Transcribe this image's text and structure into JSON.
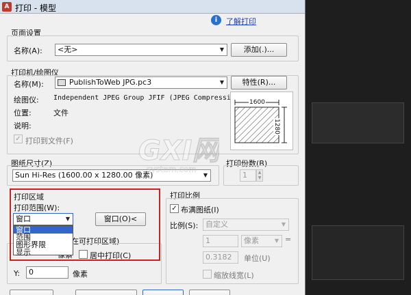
{
  "window": {
    "title": "打印 - 模型",
    "app_icon": "A"
  },
  "help": {
    "link": "了解打印"
  },
  "page_setup": {
    "group_label": "页面设置",
    "name_label": "名称(A):",
    "name_value": "<无>",
    "add_button": "添加(.)..."
  },
  "printer": {
    "group_label": "打印机/绘图仪",
    "name_label": "名称(M):",
    "name_value": "PublishToWeb JPG.pc3",
    "properties_button": "特性(R)...",
    "plotter_label": "绘图仪:",
    "plotter_value": "Independent JPEG Group JFIF (JPEG Compressi...",
    "location_label": "位置:",
    "location_value": "文件",
    "description_label": "说明:",
    "plot_to_file_label": "打印到文件(F)",
    "preview_width": "1600",
    "preview_height": "1280"
  },
  "paper_size": {
    "group_label": "图纸尺寸(Z)",
    "value": "Sun Hi-Res (1600.00 x 1280.00 像素)"
  },
  "copies": {
    "group_label": "打印份数(B)",
    "value": "1"
  },
  "plot_area": {
    "group_label": "打印区域",
    "range_label": "打印范围(W):",
    "range_value": "窗口",
    "window_button": "窗口(O)<",
    "options": [
      "窗口",
      "范围",
      "图形界限",
      "显示"
    ],
    "selected_index": 0
  },
  "plot_offset": {
    "group_label_partial": "在可打印区域)",
    "unit_x": "像素",
    "center_label": "居中打印(C)",
    "y_label": "Y:",
    "y_value": "0",
    "unit_y": "像素"
  },
  "plot_scale": {
    "group_label": "打印比例",
    "fit_label": "布满图纸(I)",
    "scale_label": "比例(S):",
    "scale_value": "自定义",
    "value1": "1",
    "unit1": "像素",
    "value2": "0.3182",
    "unit2": "单位(U)",
    "lineweights_label": "缩放线宽(L)",
    "equals": "="
  },
  "watermark": {
    "letters": "GXI网",
    "sub": "system.com"
  }
}
